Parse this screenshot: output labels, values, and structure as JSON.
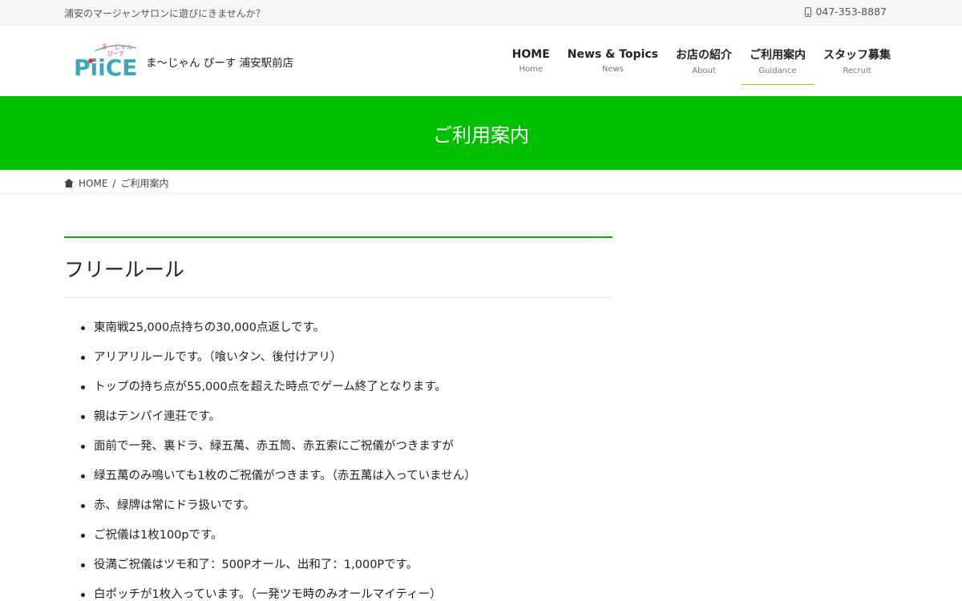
{
  "topbar": {
    "tagline": "浦安のマージャンサロンに遊びにきませんか？",
    "phone": "047-353-8887"
  },
  "header": {
    "logo_text_top": "まーじゃん",
    "logo_text_mid": "ぴーす",
    "logo_text_main": "PiiCE",
    "site_name": "ま〜じゃん ぴーす 浦安駅前店"
  },
  "nav": [
    {
      "label": "HOME",
      "sub": "Home"
    },
    {
      "label": "News & Topics",
      "sub": "News"
    },
    {
      "label": "お店の紹介",
      "sub": "About"
    },
    {
      "label": "ご利用案内",
      "sub": "Guidance"
    },
    {
      "label": "スタッフ募集",
      "sub": "Recruit"
    }
  ],
  "hero": {
    "title": "ご利用案内"
  },
  "breadcrumb": {
    "home": "HOME",
    "separator": "/",
    "current": "ご利用案内"
  },
  "section": {
    "title": "フリールール"
  },
  "rules": [
    "東南戦25,000点持ちの30,000点返しです。",
    "アリアリルールです。（喰いタン、後付けアリ）",
    "トップの持ち点が55,000点を超えた時点でゲーム終了となります。",
    "親はテンパイ連荘です。",
    "面前で一発、裏ドラ、緑五萬、赤五筒、赤五索にご祝儀がつきますが",
    "緑五萬のみ鳴いても1枚のご祝儀がつきます。（赤五萬は入っていません）",
    "赤、緑牌は常にドラ扱いです。",
    "ご祝儀は1枚100pです。",
    "役満ご祝儀はツモ和了：500Pオール、出和了：1,000Pです。",
    "白ポッチが1枚入っています。（一発ツモ時のみオールマイティー）"
  ],
  "colors": {
    "hero_bg": "#00bf00",
    "section_rule": "#1a9c1a",
    "nav_active_underline": "#9acd32",
    "logo_teal": "#3aa8b8"
  }
}
